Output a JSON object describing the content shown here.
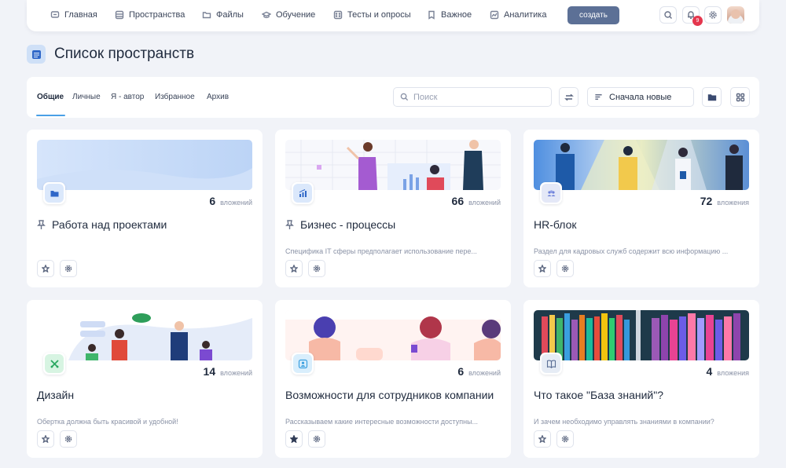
{
  "nav": {
    "items": [
      {
        "label": "Главная",
        "icon": "home-icon"
      },
      {
        "label": "Пространства",
        "icon": "spaces-icon"
      },
      {
        "label": "Файлы",
        "icon": "folder-icon"
      },
      {
        "label": "Обучение",
        "icon": "graduation-icon"
      },
      {
        "label": "Тесты и опросы",
        "icon": "test-icon"
      },
      {
        "label": "Важное",
        "icon": "bookmark-icon"
      },
      {
        "label": "Аналитика",
        "icon": "analytics-icon"
      }
    ],
    "create_label": "создать",
    "notifications_count": "9"
  },
  "page": {
    "title": "Список пространств"
  },
  "filters": {
    "tabs": [
      "Общие",
      "Личные",
      "Я - автор",
      "Избранное",
      "Архив"
    ],
    "search_placeholder": "Поиск",
    "sort_label": "Сначала новые"
  },
  "colors": {
    "accent": "#5c7096",
    "tab_underline": "#4aa0e6",
    "badge": "#e4364d"
  },
  "cards": [
    {
      "count": "6",
      "count_label": "вложений",
      "title": "Работа над проектами",
      "pinned": true,
      "description": "",
      "favorite": false,
      "icon": "folder-icon"
    },
    {
      "count": "66",
      "count_label": "вложений",
      "title": "Бизнес - процессы",
      "pinned": true,
      "description": "Специфика IT сферы предполагает использование пере...",
      "favorite": false,
      "icon": "chart-icon"
    },
    {
      "count": "72",
      "count_label": "вложения",
      "title": "HR-блок",
      "pinned": false,
      "description": "Раздел для кадровых служб содержит всю информацию ...",
      "favorite": false,
      "icon": "people-icon"
    },
    {
      "count": "14",
      "count_label": "вложений",
      "title": "Дизайн",
      "pinned": false,
      "description": "Обертка должна быть красивой и удобной!",
      "favorite": false,
      "icon": "design-icon"
    },
    {
      "count": "6",
      "count_label": "вложений",
      "title": "Возможности для сотрудников компании",
      "pinned": false,
      "description": "Рассказываем какие интересные возможности доступны...",
      "favorite": true,
      "icon": "user-card-icon"
    },
    {
      "count": "4",
      "count_label": "вложения",
      "title": "Что такое \"База знаний\"?",
      "pinned": false,
      "description": "И зачем необходимо управлять знаниями в компании?",
      "favorite": false,
      "icon": "book-icon"
    }
  ]
}
